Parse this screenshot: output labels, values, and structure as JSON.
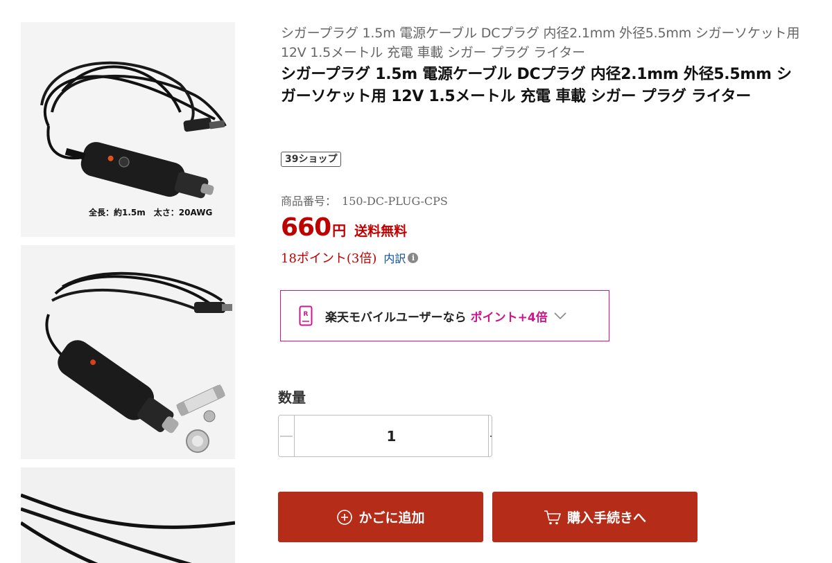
{
  "gallery": {
    "image1_caption": "全長：約1.5m　太さ：20AWG"
  },
  "product": {
    "sub_title": "シガープラグ 1.5m 電源ケーブル DCプラグ 内径2.1mm 外径5.5mm シガーソケット用 12V 1.5メートル 充電 車載 シガー プラグ ライター",
    "title": "シガープラグ 1.5m 電源ケーブル DCプラグ 内径2.1mm 外径5.5mm シガーソケット用 12V 1.5メートル 充電 車載 シガー プラグ ライター",
    "shop_badge": "39ショップ",
    "sku_label": "商品番号：",
    "sku_value": "150-DC-PLUG-CPS",
    "price": "660",
    "price_unit": "円",
    "shipping": "送料無料",
    "points": "18ポイント(3倍)",
    "points_breakdown": "内訳",
    "info_icon": "i"
  },
  "mobile_offer": {
    "text": "楽天モバイルユーザーなら",
    "highlight": "ポイント+4倍",
    "icon": "rakuten-mobile-icon"
  },
  "quantity": {
    "label": "数量",
    "value": "1"
  },
  "actions": {
    "add_to_cart": "かごに追加",
    "buy_now": "購入手続きへ"
  },
  "colors": {
    "price_red": "#bf0000",
    "button_red": "#b52c18",
    "mobile_pink": "#d1148c",
    "link_blue": "#0b4ea2"
  }
}
